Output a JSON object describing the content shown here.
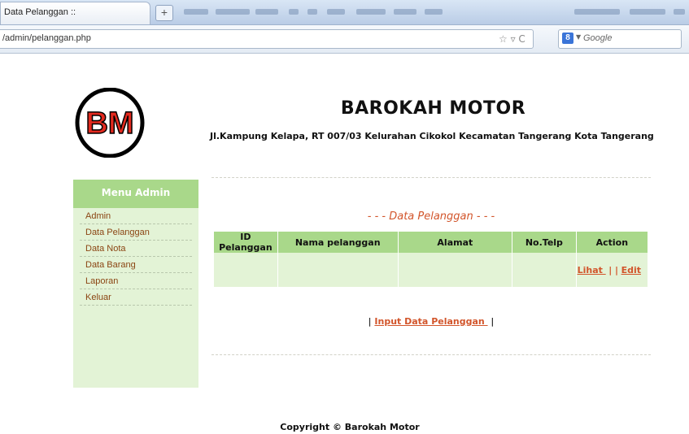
{
  "browser": {
    "tab_title": "Data Pelanggan ::",
    "new_tab_label": "+",
    "url": "/admin/pelanggan.php",
    "search_placeholder": "Google",
    "search_engine_badge": "8"
  },
  "site": {
    "logo_text": "BM",
    "title": "BAROKAH MOTOR",
    "address": "Jl.Kampung Kelapa, RT 007/03 Kelurahan Cikokol Kecamatan Tangerang Kota Tangerang"
  },
  "sidebar": {
    "header": "Menu Admin",
    "items": [
      {
        "label": "Admin"
      },
      {
        "label": "Data Pelanggan"
      },
      {
        "label": "Data Nota"
      },
      {
        "label": "Data Barang"
      },
      {
        "label": "Laporan"
      },
      {
        "label": "Keluar"
      }
    ]
  },
  "main": {
    "section_title": "- - - Data Pelanggan - - -",
    "table": {
      "columns": [
        "ID Pelanggan",
        "Nama pelanggan",
        "Alamat",
        "No.Telp",
        "Action"
      ],
      "rows": [
        {
          "id": "",
          "nama": "",
          "alamat": "",
          "telp": "",
          "actions": {
            "view": "Lihat ",
            "separator": "| |",
            "edit": "Edit"
          }
        }
      ]
    },
    "input_link": {
      "prefix": "|",
      "label": "Input Data Pelanggan ",
      "suffix": "|"
    }
  },
  "footer": {
    "copyright": "Copyright © Barokah Motor"
  },
  "colors": {
    "accent_green": "#a9d88a",
    "light_green": "#e3f3d6",
    "link_orange": "#d2552b",
    "menu_text": "#8b4513"
  }
}
